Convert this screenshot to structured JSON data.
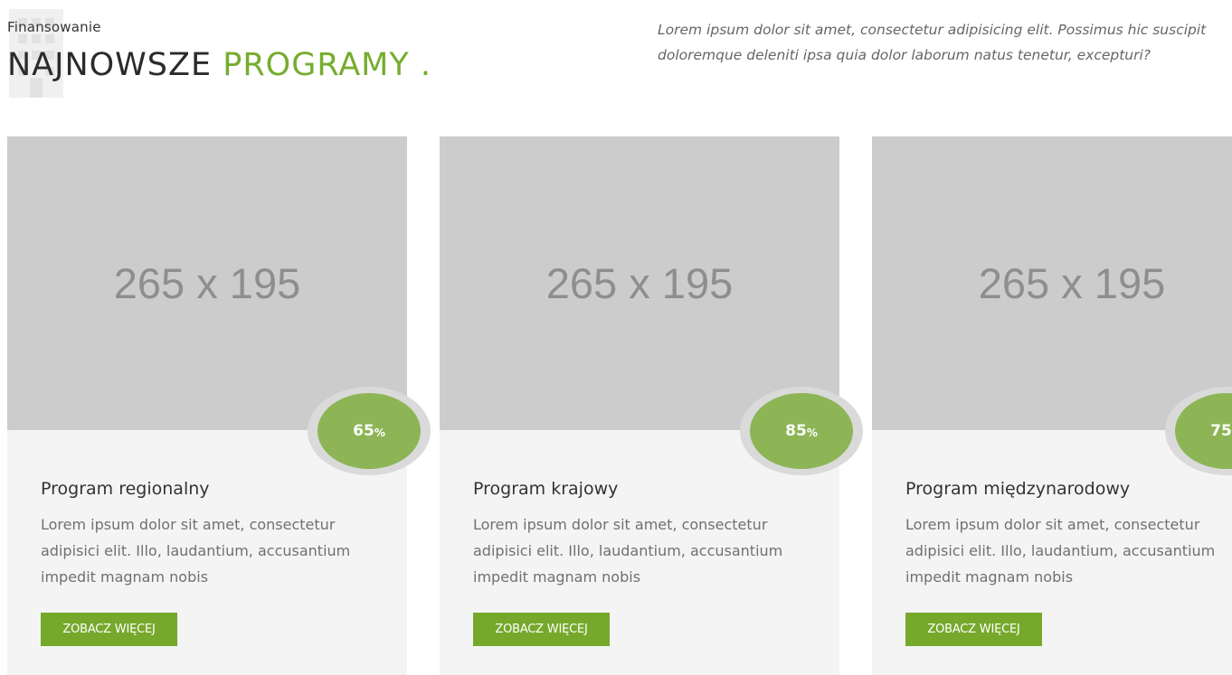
{
  "header": {
    "kicker": "Finansowanie",
    "title_main": "NAJNOWSZE ",
    "title_accent": "PROGRAMY",
    "title_suffix": " .",
    "intro": "Lorem ipsum dolor sit amet, consectetur adipisicing elit. Possimus hic suscipit doloremque deleniti ipsa quia dolor laborum natus tenetur, excepturi?"
  },
  "cards": [
    {
      "image_placeholder": "265 x 195",
      "progress_value": "65",
      "progress_unit": "%",
      "title": "Program regionalny",
      "description": "Lorem ipsum dolor sit amet, consectetur adipisici elit. Illo, laudantium, accusantium impedit magnam nobis",
      "button": "ZOBACZ WIĘCEJ"
    },
    {
      "image_placeholder": "265 x 195",
      "progress_value": "85",
      "progress_unit": "%",
      "title": "Program krajowy",
      "description": "Lorem ipsum dolor sit amet, consectetur adipisici elit. Illo, laudantium, accusantium impedit magnam nobis",
      "button": "ZOBACZ WIĘCEJ"
    },
    {
      "image_placeholder": "265 x 195",
      "progress_value": "75",
      "progress_unit": "%",
      "title": "Program międzynarodowy",
      "description": "Lorem ipsum dolor sit amet, consectetur adipisici elit. Illo, laudantium, accusantium impedit magnam nobis",
      "button": "ZOBACZ WIĘCEJ"
    }
  ],
  "colors": {
    "accent": "#76ad2e",
    "button": "#76a82b",
    "badge": "#8db556",
    "card_bg": "#f4f4f4",
    "placeholder_bg": "#cccccc"
  },
  "icons": {
    "section_icon": "building-icon"
  }
}
